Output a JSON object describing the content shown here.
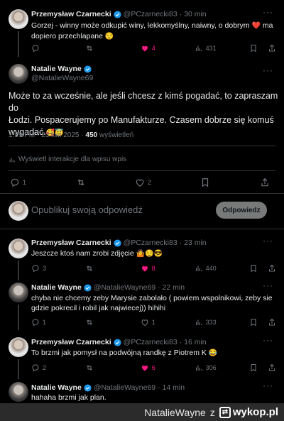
{
  "tweet1": {
    "name": "Przemysław Czarnecki",
    "handle": "@PCzarnecki83",
    "time": "· 30 min",
    "text_line1": "Gorzej - winny może odkupić winy, lekkomyślny, naiwny, o dobrym",
    "text_heart": "❤️",
    "text_line1_end": " ma",
    "text_line2": "dopiero przechlapane",
    "text_emoji": "😌",
    "likes": "4",
    "views": "431"
  },
  "main_tweet": {
    "name": "Natalie Wayne",
    "handle": "@NatalieWayne69",
    "text_line1": "Może to za wcześnie, ale jeśli chcesz z kimś pogadać, to zapraszam do",
    "text_line2": "Łodzi. Pospacerujemy po Manufakturze. Czasem dobrze się komuś",
    "text_line3": "wygadać.",
    "text_emoji": "🥰😇",
    "timestamp": "1:09 PM · 23 kwi 2025 ·",
    "views_count": "450",
    "views_label": "wyświetleń",
    "interactions_label": "Wyświetl interakcje dla wpisu wpis",
    "replies": "1",
    "likes": "2"
  },
  "compose": {
    "placeholder": "Opublikuj swoją odpowiedź",
    "button": "Odpowiedz"
  },
  "replies": [
    {
      "name": "Przemysław Czarnecki",
      "handle": "@PCzarnecki83",
      "time": "· 23 min",
      "text": "Jeszcze ktoś nam zrobi zdjęcie",
      "emoji": "🤷😌😎",
      "replies": "3",
      "likes": "8",
      "views": "440"
    },
    {
      "name": "Natalie Wayne",
      "handle": "@NatalieWayne69",
      "time": "· 22 min",
      "text_line1": "chyba nie chcemy zeby Marysie zabolało ( powiem wspolnikowi, zeby sie",
      "text_line2": "gdzie pokrecil i robil jak najwiecej)) hihihi",
      "replies": "1",
      "likes": "1",
      "views": "333"
    },
    {
      "name": "Przemysław Czarnecki",
      "handle": "@PCzarnecki83",
      "time": "· 16 min",
      "text": "To brzmi jak pomysł na podwójną randkę z Piotrem K",
      "emoji": "😂",
      "replies": "2",
      "likes": "6",
      "views": "306"
    },
    {
      "name": "Natalie Wayne",
      "handle": "@NatalieWayne69",
      "time": "· 14 min",
      "text": "hahaha brzmi jak plan."
    }
  ],
  "footer": {
    "username": "NatalieWayne",
    "z": "z",
    "site": "wykop.pl"
  },
  "colors": {
    "background": "#000000",
    "text": "#e7e9ea",
    "muted": "#71767b",
    "like_pink": "#f91880",
    "verified_blue": "#1d9bf0"
  }
}
